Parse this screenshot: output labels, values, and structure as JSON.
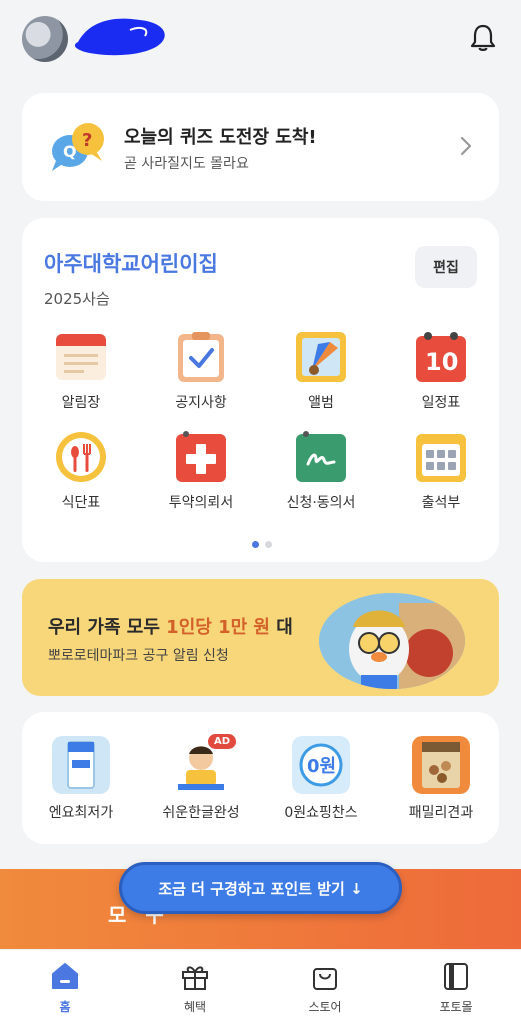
{
  "header": {
    "avatar": "avatar",
    "name_redacted": "",
    "bell_icon": "bell-icon"
  },
  "quiz": {
    "title": "오늘의 퀴즈 도전장 도착!",
    "subtitle": "곧 사라질지도 몰라요",
    "icon": "quiz-bubble-icon"
  },
  "school": {
    "name": "아주대학교어린이집",
    "year": "2025사슴",
    "edit_label": "편집",
    "menu": [
      {
        "label": "알림장",
        "icon": "notice-note-icon"
      },
      {
        "label": "공지사항",
        "icon": "checklist-icon"
      },
      {
        "label": "앨범",
        "icon": "album-icon"
      },
      {
        "label": "일정표",
        "icon": "calendar-icon",
        "day": "10"
      },
      {
        "label": "식단표",
        "icon": "meal-icon"
      },
      {
        "label": "투약의뢰서",
        "icon": "medicine-icon"
      },
      {
        "label": "신청·동의서",
        "icon": "consent-form-icon"
      },
      {
        "label": "출석부",
        "icon": "attendance-icon"
      }
    ],
    "page_count": 2,
    "current_page": 1
  },
  "banner": {
    "title_prefix": "우리 가족 모두 ",
    "title_highlight": "1인당 1만 원",
    "title_suffix": " 대",
    "subtitle": "뽀로로테마파크 공구 알림 신청",
    "colors": {
      "background": "#f8d77a",
      "highlight": "#d4602a"
    }
  },
  "shop": [
    {
      "label": "엔요최저가",
      "icon": "yogurt-icon"
    },
    {
      "label": "쉬운한글완성",
      "icon": "hangul-kid-icon",
      "badge": "AD"
    },
    {
      "label": "0원쇼핑찬스",
      "icon": "zero-won-icon"
    },
    {
      "label": "패밀리견과",
      "icon": "nuts-icon"
    }
  ],
  "promo": {
    "text": "모 구",
    "cta": "조금 더 구경하고 포인트 받기 ↓"
  },
  "tabs": [
    {
      "label": "홈",
      "icon": "home-icon",
      "active": true
    },
    {
      "label": "혜택",
      "icon": "gift-icon",
      "active": false
    },
    {
      "label": "스토어",
      "icon": "shopping-bag-icon",
      "active": false
    },
    {
      "label": "포토몰",
      "icon": "photo-book-icon",
      "active": false
    }
  ],
  "colors": {
    "accent": "#4a78e0",
    "promo_orange": "#f08a3c",
    "cta_blue": "#3d7be6"
  }
}
